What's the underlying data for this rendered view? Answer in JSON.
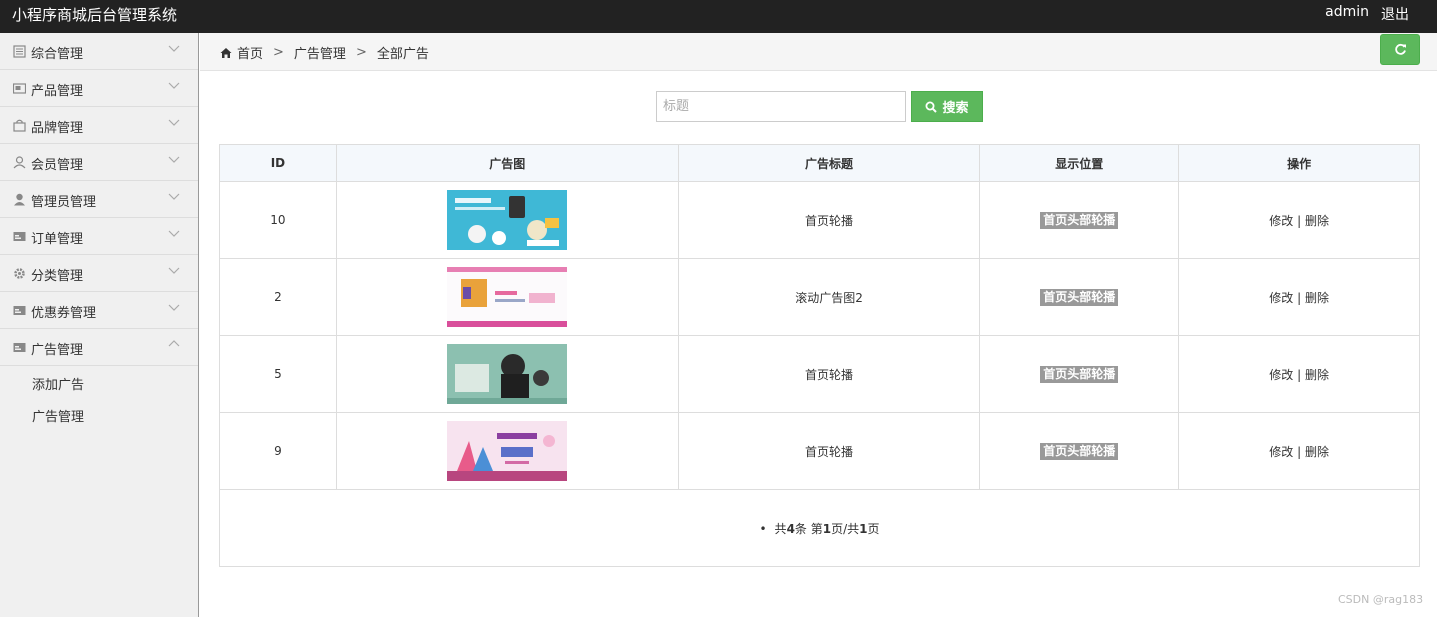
{
  "header": {
    "title": "小程序商城后台管理系统",
    "user": "admin",
    "logout": "退出"
  },
  "sidebar": {
    "items": [
      {
        "label": "综合管理",
        "icon": "list-icon"
      },
      {
        "label": "产品管理",
        "icon": "image-icon"
      },
      {
        "label": "品牌管理",
        "icon": "bag-icon"
      },
      {
        "label": "会员管理",
        "icon": "user-outline-icon"
      },
      {
        "label": "管理员管理",
        "icon": "user-icon"
      },
      {
        "label": "订单管理",
        "icon": "card-icon"
      },
      {
        "label": "分类管理",
        "icon": "gear-icon"
      },
      {
        "label": "优惠券管理",
        "icon": "card-icon"
      },
      {
        "label": "广告管理",
        "icon": "card-icon",
        "expanded": true
      }
    ],
    "submenu": [
      "添加广告",
      "广告管理"
    ]
  },
  "breadcrumb": {
    "home": "首页",
    "level1": "广告管理",
    "level2": "全部广告",
    "separator": ">"
  },
  "search": {
    "placeholder": "标题",
    "value": "",
    "button": "搜索"
  },
  "table": {
    "headers": [
      "ID",
      "广告图",
      "广告标题",
      "显示位置",
      "操作"
    ],
    "rows": [
      {
        "id": "10",
        "title": "首页轮播",
        "position": "首页头部轮播",
        "edit": "修改",
        "sep": "|",
        "delete": "删除"
      },
      {
        "id": "2",
        "title": "滚动广告图2",
        "position": "首页头部轮播",
        "edit": "修改",
        "sep": "|",
        "delete": "删除"
      },
      {
        "id": "5",
        "title": "首页轮播",
        "position": "首页头部轮播",
        "edit": "修改",
        "sep": "|",
        "delete": "删除"
      },
      {
        "id": "9",
        "title": "首页轮播",
        "position": "首页头部轮播",
        "edit": "修改",
        "sep": "|",
        "delete": "删除"
      }
    ],
    "pager": {
      "prefix": "共",
      "total": "4",
      "mid": "条 第",
      "page": "1",
      "mid2": "页/共",
      "pages": "1",
      "suffix": "页"
    }
  },
  "watermark": "CSDN @rag183",
  "colors": {
    "topbar": "#222222",
    "accent_green": "#5cb85c",
    "badge": "#999999"
  }
}
